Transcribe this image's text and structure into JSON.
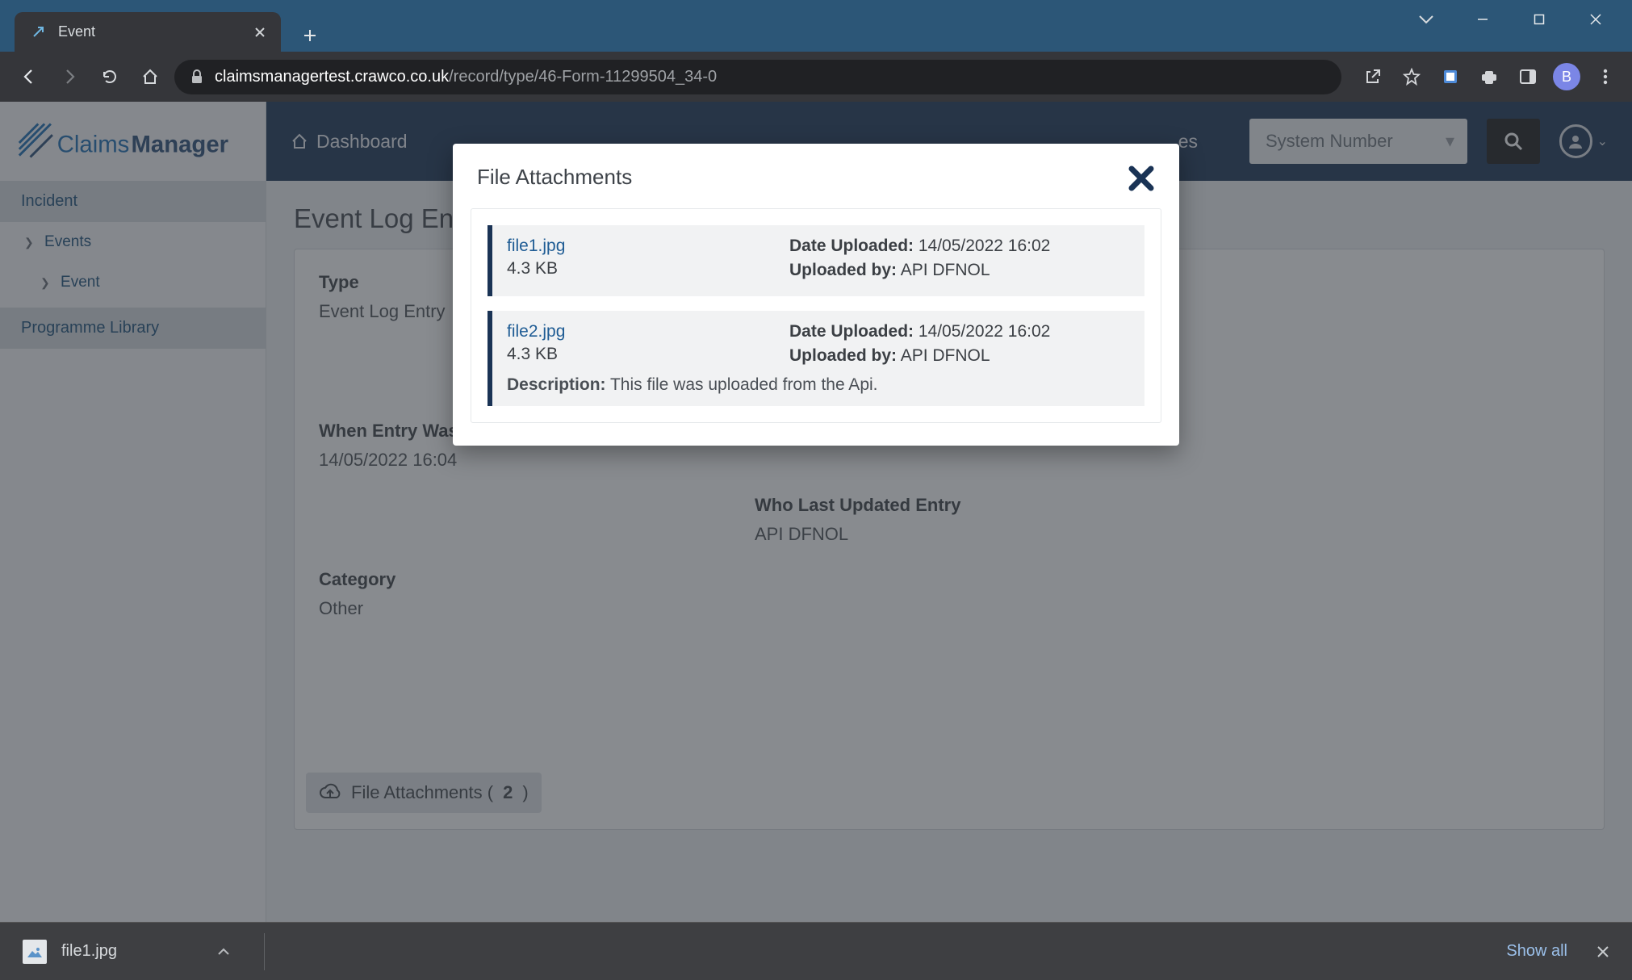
{
  "browser": {
    "tab_title": "Event",
    "url_host": "claimsmanagertest.crawco.co.uk",
    "url_path": "/record/type/46-Form-11299504_34-0",
    "profile_letter": "B"
  },
  "app": {
    "logo_brand": "ClaimsManager",
    "dashboard_label": "Dashboard",
    "hidden_nav_label": "es",
    "search_dropdown": "System Number"
  },
  "sidebar": {
    "items": [
      {
        "label": "Incident"
      },
      {
        "label": "Events"
      },
      {
        "label": "Event"
      },
      {
        "label": "Programme Library"
      }
    ]
  },
  "page": {
    "title": "Event Log Ent",
    "fields": [
      {
        "label": "Type",
        "value": "Event Log Entry"
      },
      {
        "label": "When Entry Was Last Updated",
        "value": "14/05/2022 16:04"
      },
      {
        "label": "When Entry Was F",
        "value": "14/05/2022 16:04"
      },
      {
        "label": "Who Last Updated Entry",
        "value": "API DFNOL"
      },
      {
        "label": "Category",
        "value": "Other"
      }
    ],
    "attach_label_prefix": "File Attachments (",
    "attach_count": "2",
    "attach_label_suffix": ")"
  },
  "modal": {
    "title": "File Attachments",
    "date_label": "Date Uploaded:",
    "uploader_label": "Uploaded by:",
    "description_label": "Description:",
    "attachments": [
      {
        "filename": "file1.jpg",
        "size": "4.3 KB",
        "date": "14/05/2022 16:02",
        "uploader": "API DFNOL",
        "description": null
      },
      {
        "filename": "file2.jpg",
        "size": "4.3 KB",
        "date": "14/05/2022 16:02",
        "uploader": "API DFNOL",
        "description": "This file was uploaded from the Api."
      }
    ]
  },
  "downloads": {
    "item_name": "file1.jpg",
    "show_all": "Show all"
  }
}
